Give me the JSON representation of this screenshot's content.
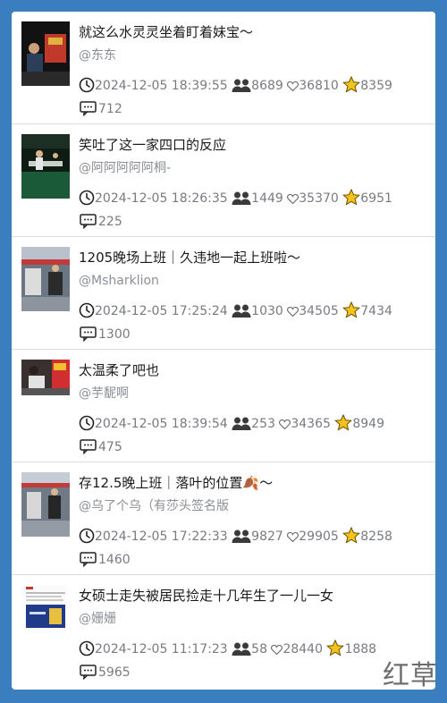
{
  "icons": {
    "time": "clock-icon",
    "followers": "group-icon",
    "likes": "heart-icon",
    "favorites": "star-icon",
    "comments": "comment-icon"
  },
  "colors": {
    "background": "#3a7ebf",
    "star": "#f3c21b",
    "title": "#1a1a1a",
    "meta": "#777b82"
  },
  "posts": [
    {
      "title": "就这么水灵灵坐着盯着妹宝～",
      "author": "@东东",
      "time": "2024-12-05 18:39:55",
      "followers": "8689",
      "likes": "36810",
      "favorites": "8359",
      "comments": "712"
    },
    {
      "title": "笑吐了这一家四口的反应",
      "author": "@阿阿阿阿阿桐-",
      "time": "2024-12-05 18:26:35",
      "followers": "1449",
      "likes": "35370",
      "favorites": "6951",
      "comments": "225"
    },
    {
      "title": "1205晚场上班｜久违地一起上班啦～",
      "author": "@Msharklion",
      "time": "2024-12-05 17:25:24",
      "followers": "1030",
      "likes": "34505",
      "favorites": "7434",
      "comments": "1300"
    },
    {
      "title": "太温柔了吧也",
      "author": "@芋馜啊",
      "time": "2024-12-05 18:39:54",
      "followers": "253",
      "likes": "34365",
      "favorites": "8949",
      "comments": "475"
    },
    {
      "title": "存12.5晚上班｜落叶的位置🍂～",
      "author": "@乌了个乌（有莎头签名版",
      "time": "2024-12-05 17:22:33",
      "followers": "9827",
      "likes": "29905",
      "favorites": "8258",
      "comments": "1460"
    },
    {
      "title": "女硕士走失被居民捡走十几年生了一儿一女",
      "author": "@姗姗",
      "time": "2024-12-05 11:17:23",
      "followers": "58",
      "likes": "28440",
      "favorites": "1888",
      "comments": "5965"
    }
  ],
  "watermark": "红草"
}
